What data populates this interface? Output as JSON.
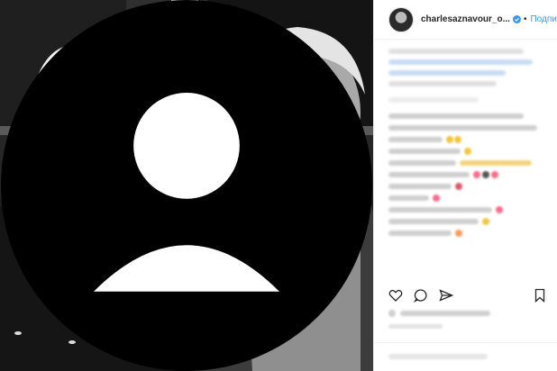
{
  "post": {
    "username": "charlesaznavour_o...",
    "follow_label": "Подписка",
    "separator": "•"
  },
  "photo": {
    "description_icon": "person-tag-icon"
  },
  "actions": {
    "icons": [
      "heart-icon",
      "comment-icon",
      "share-icon",
      "bookmark-icon"
    ]
  },
  "colors": {
    "follow_blue": "#3897f0",
    "verified_blue": "#3897f0",
    "border": "#efefef",
    "text": "#262626"
  }
}
